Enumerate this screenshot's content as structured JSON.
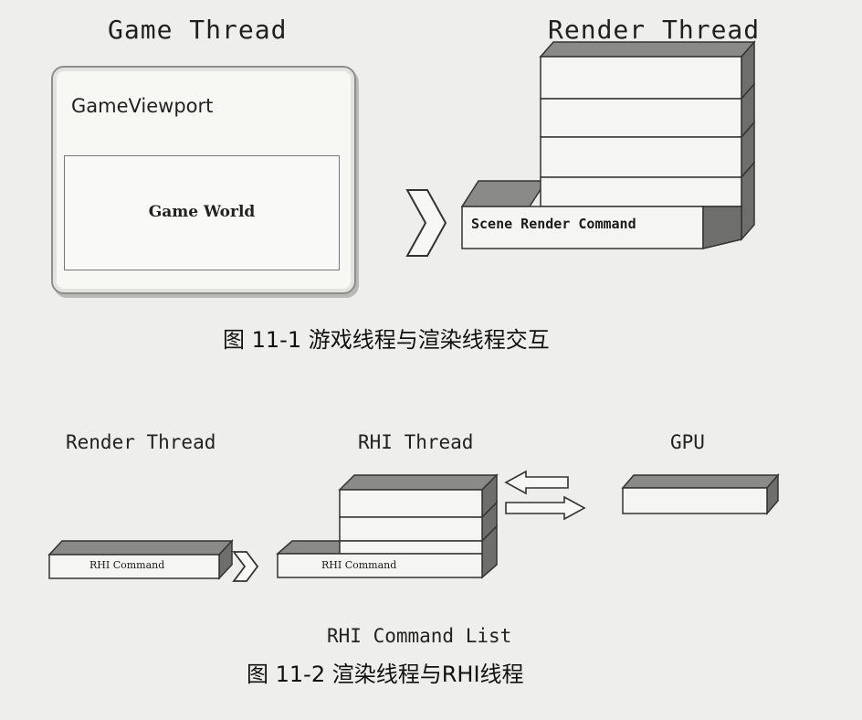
{
  "figure1": {
    "game_thread_title": "Game Thread",
    "render_thread_title": "Render Thread",
    "viewport_label": "GameViewport",
    "world_label": "Game World",
    "command_label": "Scene Render Command",
    "caption": "图 11-1   游戏线程与渲染线程交互"
  },
  "figure2": {
    "render_thread_title": "Render Thread",
    "rhi_thread_title": "RHI Thread",
    "gpu_title": "GPU",
    "render_command_label": "RHI Command",
    "rhi_command_label": "RHI Command",
    "command_list_label": "RHI Command List",
    "caption": "图 11-2   渲染线程与RHI线程"
  },
  "colors": {
    "box_face": "#f5f5f3",
    "box_top": "#8a8a88",
    "box_side": "#6e6e6c",
    "outline": "#333333"
  }
}
